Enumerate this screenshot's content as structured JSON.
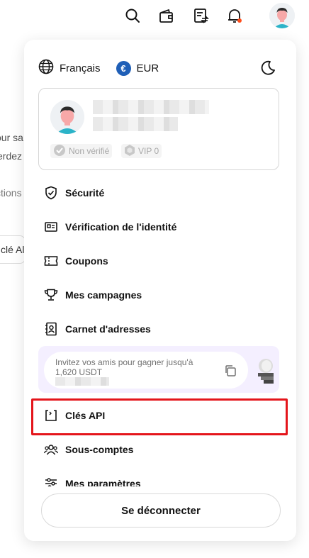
{
  "header": {
    "icons": [
      "search-icon",
      "wallet-icon",
      "orders-icon",
      "bell-icon",
      "avatar"
    ],
    "notification_dot_color": "#ff4d1a"
  },
  "background_page": {
    "fragments": [
      "our sa",
      "erdez",
      "ctions",
      "clé Al"
    ]
  },
  "panel": {
    "language_label": "Français",
    "currency_symbol": "€",
    "currency_label": "EUR",
    "profile": {
      "badge_verification": "Non vérifié",
      "badge_vip": "VIP 0"
    },
    "menu": [
      {
        "label": "Sécurité",
        "icon": "shield-icon"
      },
      {
        "label": "Vérification de l'identité",
        "icon": "id-card-icon"
      },
      {
        "label": "Coupons",
        "icon": "ticket-icon"
      },
      {
        "label": "Mes campagnes",
        "icon": "trophy-icon"
      },
      {
        "label": "Carnet d'adresses",
        "icon": "address-book-icon"
      }
    ],
    "invite": {
      "text_line1": "Invitez vos amis pour gagner jusqu'à",
      "text_line2": "1,620 USDT"
    },
    "menu_lower": [
      {
        "label": "Clés API",
        "icon": "api-key-icon"
      },
      {
        "label": "Sous-comptes",
        "icon": "users-icon"
      },
      {
        "label": "Mes paramètres",
        "icon": "sliders-icon"
      }
    ],
    "logout_label": "Se déconnecter",
    "highlight_color": "#e4151b"
  }
}
